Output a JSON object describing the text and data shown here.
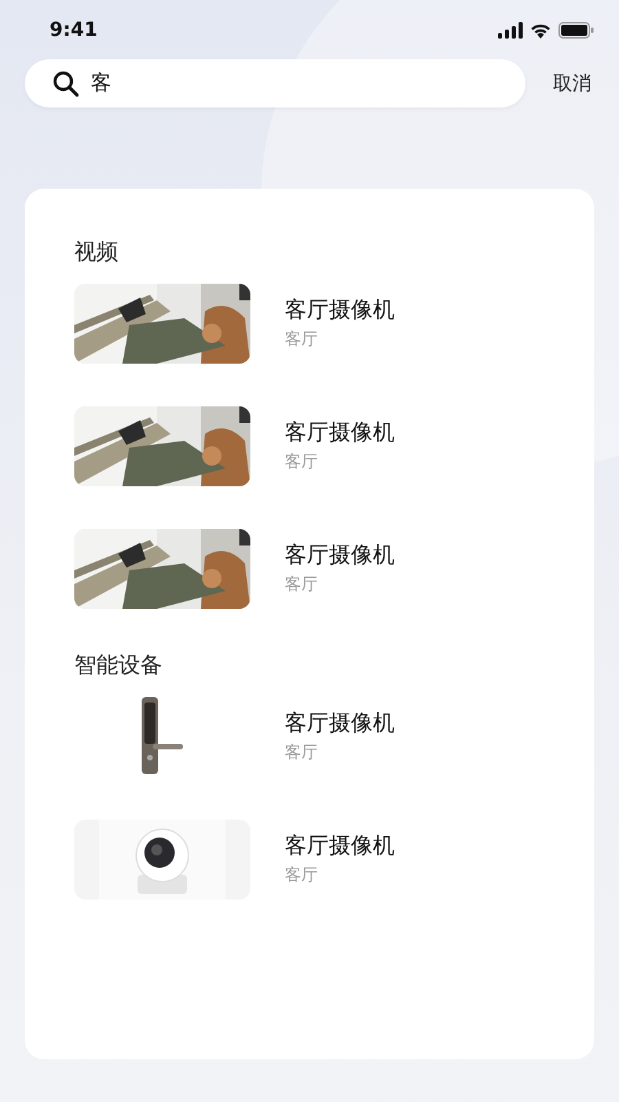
{
  "status_bar": {
    "time": "9:41"
  },
  "search": {
    "value": "客",
    "cancel": "取消"
  },
  "sections": [
    {
      "title": "视频",
      "kind": "video",
      "items": [
        {
          "title": "客厅摄像机",
          "subtitle": "客厅"
        },
        {
          "title": "客厅摄像机",
          "subtitle": "客厅"
        },
        {
          "title": "客厅摄像机",
          "subtitle": "客厅"
        }
      ]
    },
    {
      "title": "智能设备",
      "kind": "device",
      "items": [
        {
          "title": "客厅摄像机",
          "subtitle": "客厅"
        },
        {
          "title": "客厅摄像机",
          "subtitle": "客厅"
        }
      ]
    }
  ]
}
